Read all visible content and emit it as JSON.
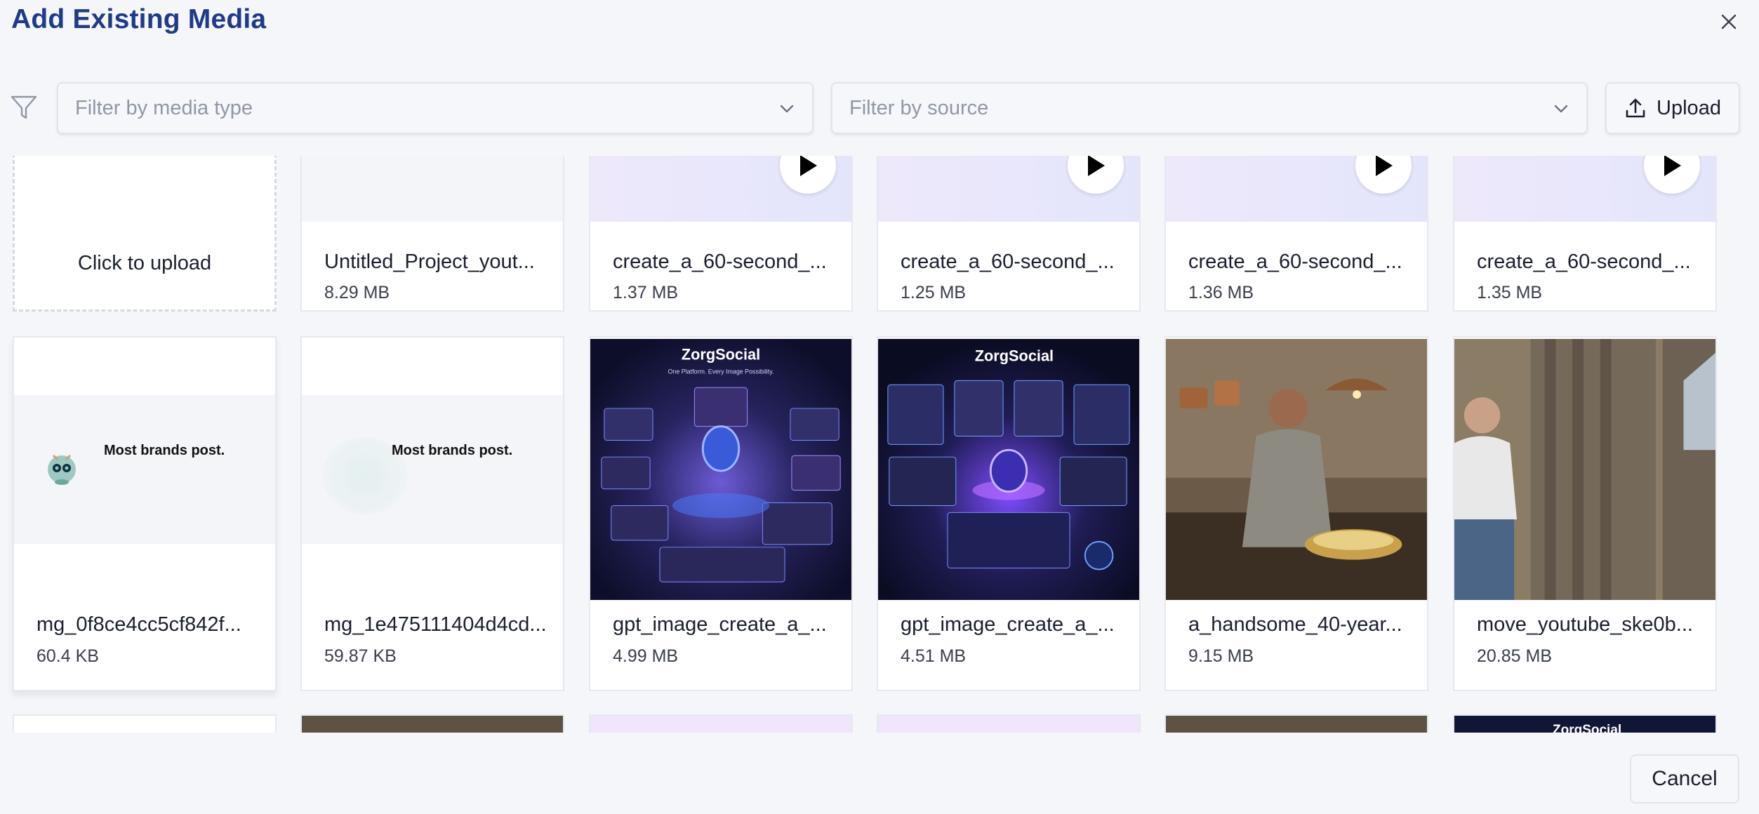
{
  "dialog": {
    "title": "Add Existing Media",
    "close_icon": "close-icon",
    "cancel_label": "Cancel"
  },
  "filters": {
    "icon": "filter-icon",
    "media_type_placeholder": "Filter by media type",
    "source_placeholder": "Filter by source",
    "upload_label": "Upload"
  },
  "grid": {
    "upload_tile_label": "Click to upload",
    "row1": [
      {
        "name": "Untitled_Project_yout...",
        "size": "8.29 MB",
        "type": "video"
      },
      {
        "name": "create_a_60-second_...",
        "size": "1.37 MB",
        "type": "video"
      },
      {
        "name": "create_a_60-second_...",
        "size": "1.25 MB",
        "type": "video"
      },
      {
        "name": "create_a_60-second_...",
        "size": "1.36 MB",
        "type": "video"
      },
      {
        "name": "create_a_60-second_...",
        "size": "1.35 MB",
        "type": "video"
      }
    ],
    "row2": [
      {
        "name": "mg_0f8ce4cc5cf842f...",
        "size": "60.4 KB",
        "thumb_text": "Most brands post."
      },
      {
        "name": "mg_1e475111404d4cd...",
        "size": "59.87 KB",
        "thumb_text": "Most brands post."
      },
      {
        "name": "gpt_image_create_a_...",
        "size": "4.99 MB",
        "brand": "ZorgSocial",
        "subtitle": "One Platform. Every Image Possibility."
      },
      {
        "name": "gpt_image_create_a_...",
        "size": "4.51 MB",
        "brand": "ZorgSocial"
      },
      {
        "name": "a_handsome_40-year...",
        "size": "9.15 MB"
      },
      {
        "name": "move_youtube_ske0b...",
        "size": "20.85 MB"
      }
    ],
    "row3_brand": "ZorgSocial"
  },
  "colors": {
    "title": "#1f3a8a",
    "background": "#f5f6fa",
    "card": "#ffffff"
  }
}
